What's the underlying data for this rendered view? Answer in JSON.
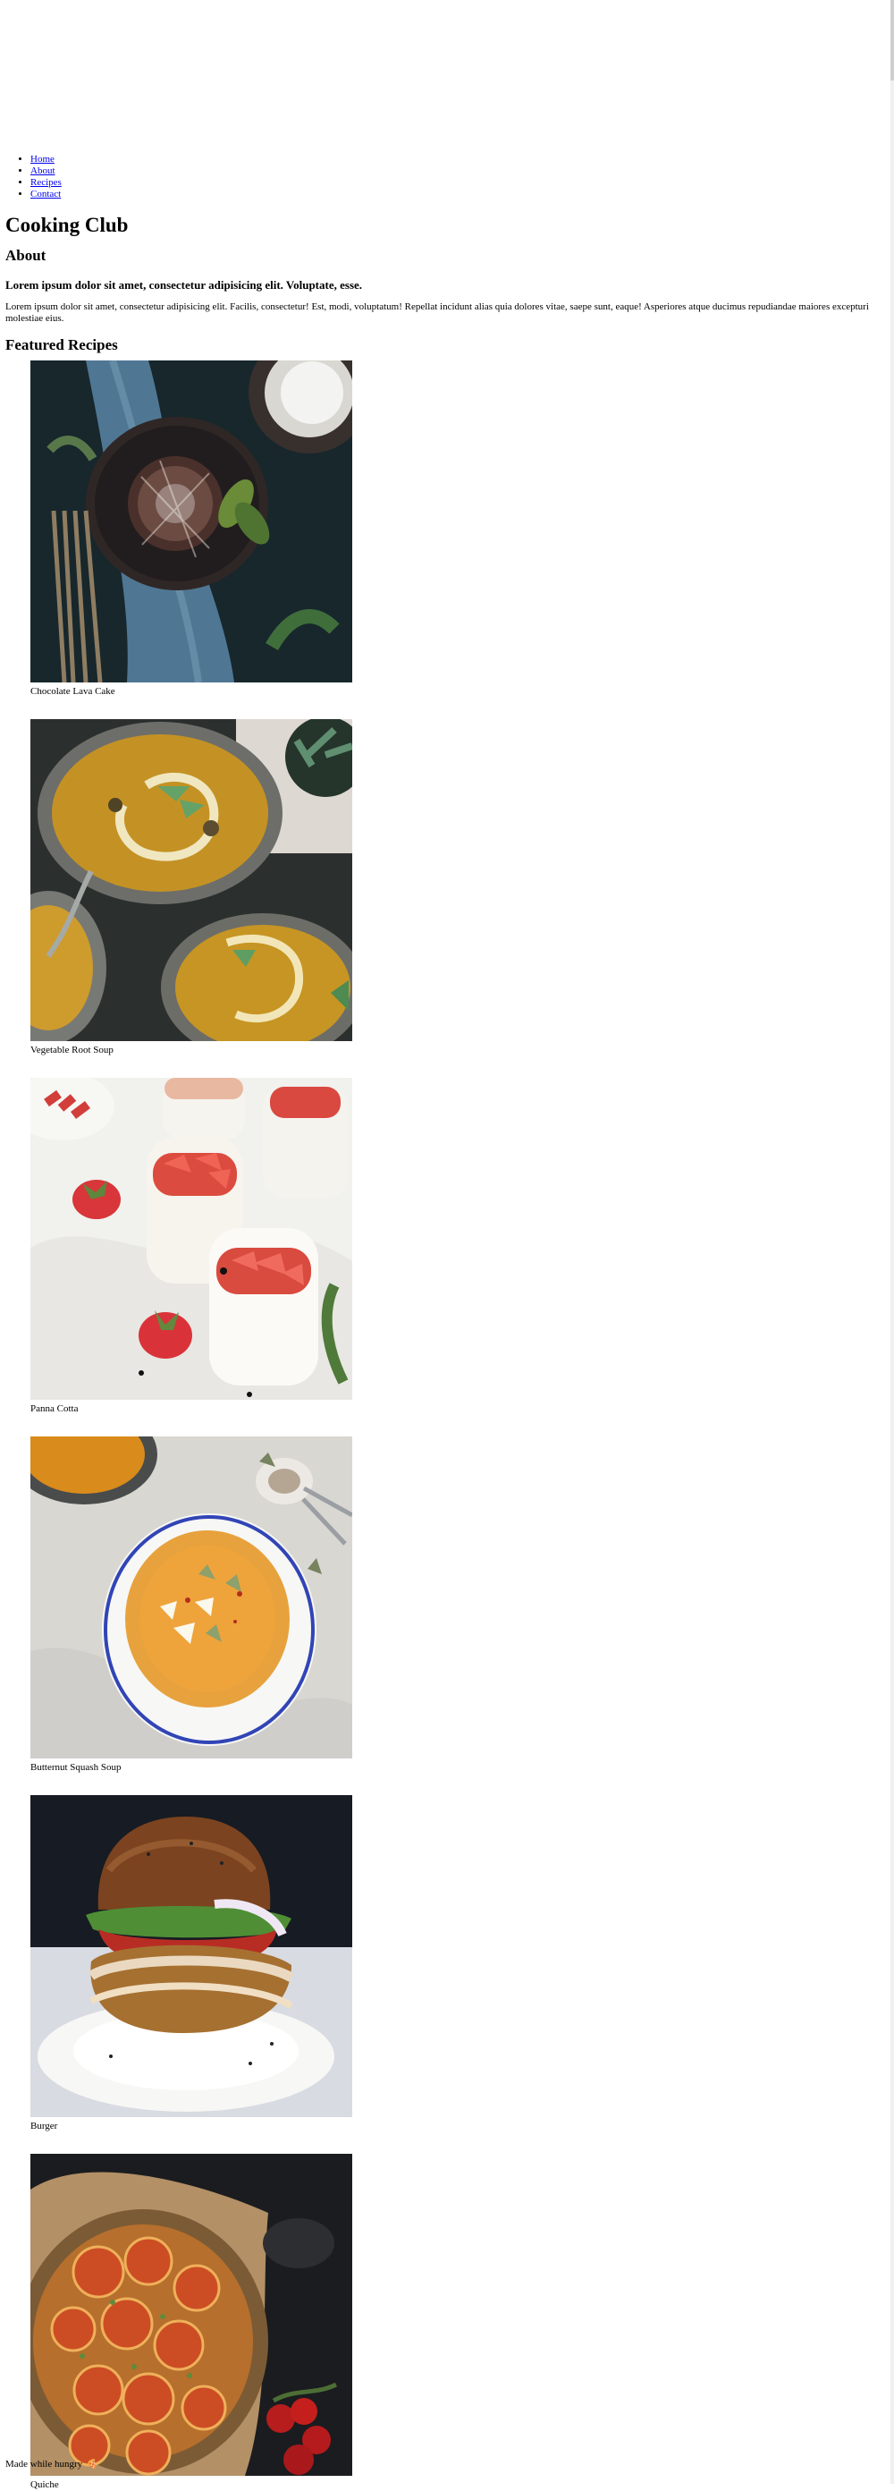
{
  "nav": {
    "items": [
      {
        "label": "Home"
      },
      {
        "label": "About"
      },
      {
        "label": "Recipes"
      },
      {
        "label": "Contact"
      }
    ]
  },
  "site": {
    "title": "Cooking Club"
  },
  "about": {
    "title": "About",
    "subheading": "Lorem ipsum dolor sit amet, consectetur adipisicing elit. Voluptate, esse.",
    "body": "Lorem ipsum dolor sit amet, consectetur adipisicing elit. Facilis, consectetur! Est, modi, voluptatum! Repellat incidunt alias quia dolores vitae, saepe sunt, eaque! Asperiores atque ducimus repudiandae maiores excepturi molestiae eius."
  },
  "recipes": {
    "title": "Featured Recipes",
    "items": [
      {
        "name": "Chocolate Lava Cake"
      },
      {
        "name": "Vegetable Root Soup"
      },
      {
        "name": "Panna Cotta"
      },
      {
        "name": "Butternut Squash Soup"
      },
      {
        "name": "Burger"
      },
      {
        "name": "Quiche"
      }
    ]
  },
  "footer": {
    "text": "Made while hungry",
    "icon": "pizza-icon"
  }
}
